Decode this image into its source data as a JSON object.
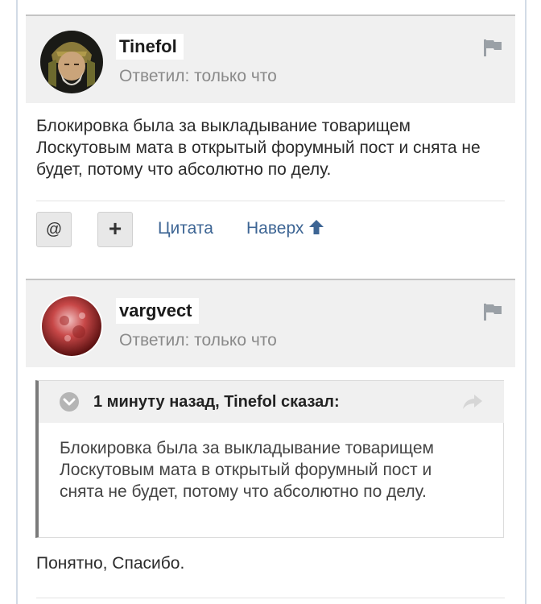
{
  "colors": {
    "link": "#3d6594",
    "header_bg": "#f0f0f0",
    "muted_text": "#8a8a8a"
  },
  "posts": [
    {
      "author": "Tinefol",
      "reply_time": "Ответил: только что",
      "body": "Блокировка была за выкладывание товарищем Лоскутовым мата в открытый форумный пост и снята не будет, потому что абсолютно по делу.",
      "actions": {
        "mention_label": "@",
        "multiquote_label": "+",
        "quote_label": "Цитата",
        "top_label": "Наверх"
      }
    },
    {
      "author": "vargvect",
      "reply_time": "Ответил: только что",
      "quote": {
        "cite": "1 минуту назад, Tinefol сказал:",
        "text": "Блокировка была за выкладывание товарищем Лоскутовым мата в открытый форумный пост и снята не будет, потому что абсолютно по делу."
      },
      "body": "Понятно, Спасибо."
    }
  ]
}
